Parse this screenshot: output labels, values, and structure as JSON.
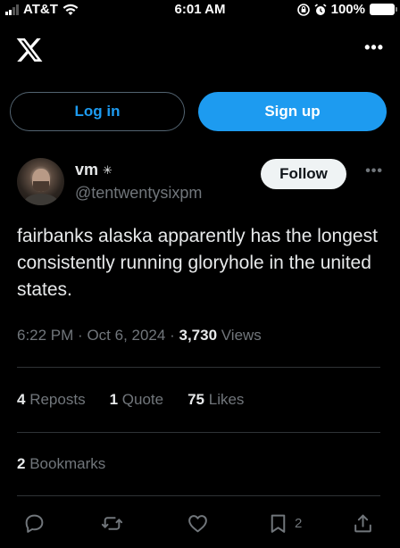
{
  "status_bar": {
    "carrier": "AT&T",
    "time": "6:01 AM",
    "battery": "100%",
    "icons": [
      "signal-icon",
      "wifi-icon",
      "orientation-lock-icon",
      "alarm-icon",
      "battery-icon"
    ]
  },
  "nav": {
    "logo_icon": "x-logo-icon",
    "more_icon": "more-options-icon",
    "more_glyph": "•••"
  },
  "auth": {
    "login_label": "Log in",
    "signup_label": "Sign up"
  },
  "author": {
    "display_name": "vm",
    "name_glyph": "✳",
    "handle": "@tentwentysixpm",
    "follow_label": "Follow",
    "more_glyph": "•••"
  },
  "tweet": {
    "text": "fairbanks alaska apparently has the longest consistently running gloryhole in the united states.",
    "time": "6:22 PM",
    "date": "Oct 6, 2024",
    "separator": "·",
    "views_count": "3,730",
    "views_label": "Views"
  },
  "stats": {
    "reposts_count": "4",
    "reposts_label": "Reposts",
    "quotes_count": "1",
    "quotes_label": "Quote",
    "likes_count": "75",
    "likes_label": "Likes",
    "bookmarks_count": "2",
    "bookmarks_label": "Bookmarks"
  },
  "actions": {
    "reply_icon": "reply-icon",
    "repost_icon": "repost-icon",
    "like_icon": "heart-icon",
    "bookmark_icon": "bookmark-icon",
    "bookmark_count": "2",
    "share_icon": "share-icon"
  },
  "colors": {
    "background": "#000000",
    "accent": "#1d9bf0",
    "text_primary": "#e7e9ea",
    "text_secondary": "#71767b",
    "divider": "#2f3336"
  }
}
